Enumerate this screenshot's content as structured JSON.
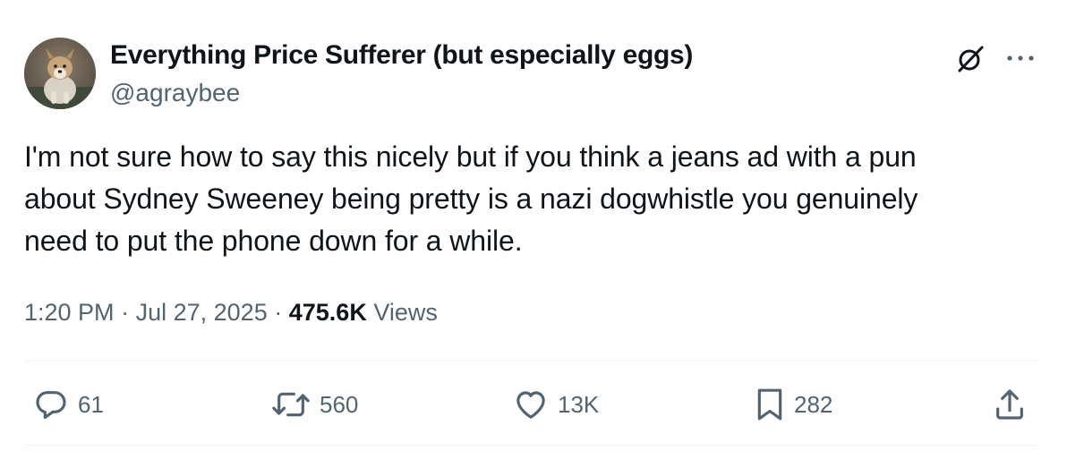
{
  "author": {
    "display_name": "Everything Price Sufferer (but especially eggs)",
    "handle": "@agraybee",
    "avatar_icon": "dog-photo-avatar"
  },
  "header_actions": {
    "grok_icon": "grok-icon",
    "more_icon": "more-options-icon"
  },
  "tweet": {
    "text": "I'm not sure how to say this nicely but if you think a jeans ad with a pun\nabout Sydney Sweeney being pretty is a nazi dogwhistle you genuinely\nneed to put the phone down for a while."
  },
  "meta": {
    "time": "1:20 PM",
    "separator": "·",
    "date": "Jul 27, 2025",
    "views_count": "475.6K",
    "views_label": "Views"
  },
  "actions": {
    "reply": {
      "icon": "reply-icon",
      "count": "61"
    },
    "repost": {
      "icon": "repost-icon",
      "count": "560"
    },
    "like": {
      "icon": "heart-icon",
      "count": "13K"
    },
    "bookmark": {
      "icon": "bookmark-icon",
      "count": "282"
    },
    "share": {
      "icon": "share-icon"
    }
  },
  "colors": {
    "text_primary": "#0f1419",
    "text_secondary": "#536471",
    "divider": "#eff3f4",
    "background": "#ffffff"
  }
}
